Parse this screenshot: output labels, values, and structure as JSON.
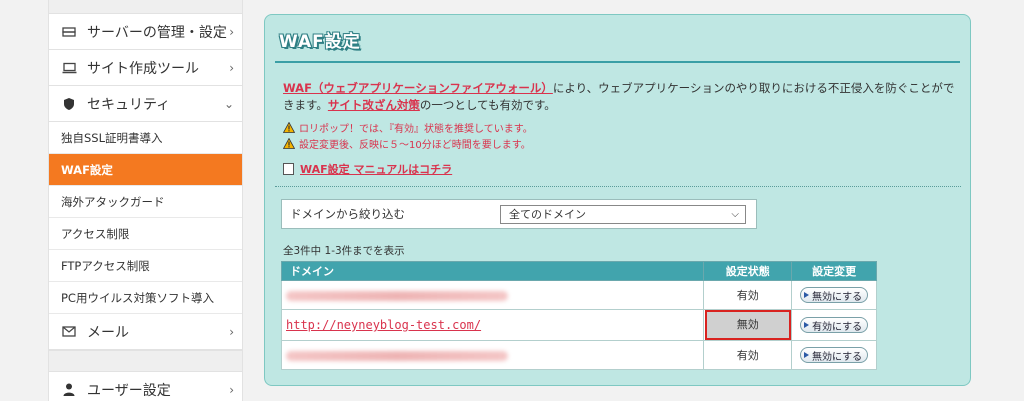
{
  "sidebar": {
    "items": [
      {
        "label": "サーバーの管理・設定",
        "icon": "server-icon"
      },
      {
        "label": "サイト作成ツール",
        "icon": "laptop-icon"
      },
      {
        "label": "セキュリティ",
        "icon": "shield-icon"
      }
    ],
    "security_sub": [
      {
        "label": "独自SSL証明書導入"
      },
      {
        "label": "WAF設定"
      },
      {
        "label": "海外アタックガード"
      },
      {
        "label": "アクセス制限"
      },
      {
        "label": "FTPアクセス制限"
      },
      {
        "label": "PC用ウイルス対策ソフト導入"
      }
    ],
    "mail": {
      "label": "メール",
      "icon": "mail-icon"
    },
    "user": {
      "label": "ユーザー設定",
      "icon": "user-icon"
    }
  },
  "panel": {
    "title": "WAF設定",
    "desc_link1": "WAF（ウェブアプリケーションファイアウォール）",
    "desc_text1": "により、ウェブアプリケーションのやり取りにおける不正侵入を防ぐことができます。",
    "desc_link2": "サイト改ざん対策",
    "desc_text2": "の一つとしても有効です。",
    "warn1": "ロリポップ！では、『有効』状態を推奨しています。",
    "warn2": "設定変更後、反映に５～10分ほど時間を要します。",
    "manual": "WAF設定 マニュアルはコチラ",
    "filter_label": "ドメインから絞り込む",
    "filter_value": "全てのドメイン",
    "count": "全3件中 1-3件までを表示"
  },
  "table": {
    "headers": {
      "domain": "ドメイン",
      "status": "設定状態",
      "action": "設定変更"
    },
    "rows": [
      {
        "domain": "",
        "status": "有効",
        "action": "無効にする"
      },
      {
        "domain": "http://neyneyblog-test.com/",
        "status": "無効",
        "action": "有効にする"
      },
      {
        "domain": "",
        "status": "有効",
        "action": "無効にする"
      }
    ]
  },
  "colors": {
    "accent": "#f47920",
    "panel_bg": "#bfe7e3",
    "table_header": "#41a4ad",
    "link": "#d9334d",
    "highlight_border": "#d9221f"
  }
}
